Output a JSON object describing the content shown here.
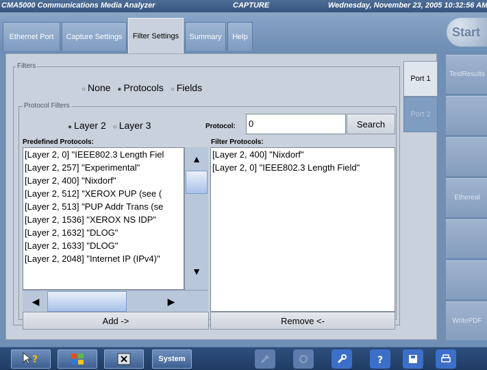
{
  "titlebar": {
    "app_title": "CMA5000 Communications Media Analyzer",
    "mode": "CAPTURE",
    "datetime": "Wednesday, November 23, 2005 10:32:56 AM"
  },
  "tabs": [
    {
      "label": "Ethernet Port"
    },
    {
      "label": "Capture Settings"
    },
    {
      "label": "Filter Settings"
    },
    {
      "label": "Summary"
    },
    {
      "label": "Help"
    }
  ],
  "start_label": "Start",
  "filters": {
    "group_label": "Filters",
    "options": [
      "None",
      "Protocols",
      "Fields"
    ],
    "selected": "Protocols"
  },
  "protocol_filters": {
    "group_label": "Protocol Filters",
    "layer_options": [
      "Layer 2",
      "Layer 3"
    ],
    "selected_layer": "Layer 2",
    "protocol_label": "Protocol:",
    "protocol_value": "0",
    "search_label": "Search",
    "predefined_label": "Predefined Protocols:",
    "filter_label": "Filter Protocols:",
    "predefined_items": [
      "[Layer 2, 0] \"IEEE802.3 Length Fiel",
      "[Layer 2, 257] \"Experimental\"",
      "[Layer 2, 400] \"Nixdorf\"",
      "[Layer 2, 512] \"XEROX PUP (see (",
      "[Layer 2, 513] \"PUP Addr Trans (se",
      "[Layer 2, 1536] \"XEROX NS IDP\"",
      "[Layer 2, 1632] \"DLOG\"",
      "[Layer 2, 1633] \"DLOG\"",
      "[Layer 2, 2048] \"Internet IP (IPv4)\""
    ],
    "filter_items": [
      "[Layer 2, 400] \"Nixdorf\"",
      "[Layer 2, 0] \"IEEE802.3 Length Field\""
    ],
    "add_label": "Add ->",
    "remove_label": "Remove <-"
  },
  "ports": [
    {
      "label": "Port 1"
    },
    {
      "label": "Port 2"
    }
  ],
  "right_buttons": [
    {
      "line1": "Test",
      "line2": "Results"
    },
    {
      "line1": "",
      "line2": ""
    },
    {
      "line1": "",
      "line2": ""
    },
    {
      "line1": "Ethereal",
      "line2": ""
    },
    {
      "line1": "",
      "line2": ""
    },
    {
      "line1": "",
      "line2": ""
    },
    {
      "line1": "Write",
      "line2": "PDF"
    }
  ],
  "taskbar": {
    "system_label": "System"
  },
  "icons": {
    "scroll_up": "▲",
    "scroll_down": "▼",
    "scroll_left": "◀",
    "scroll_right": "▶",
    "radio_off": "○",
    "radio_on": "●"
  }
}
